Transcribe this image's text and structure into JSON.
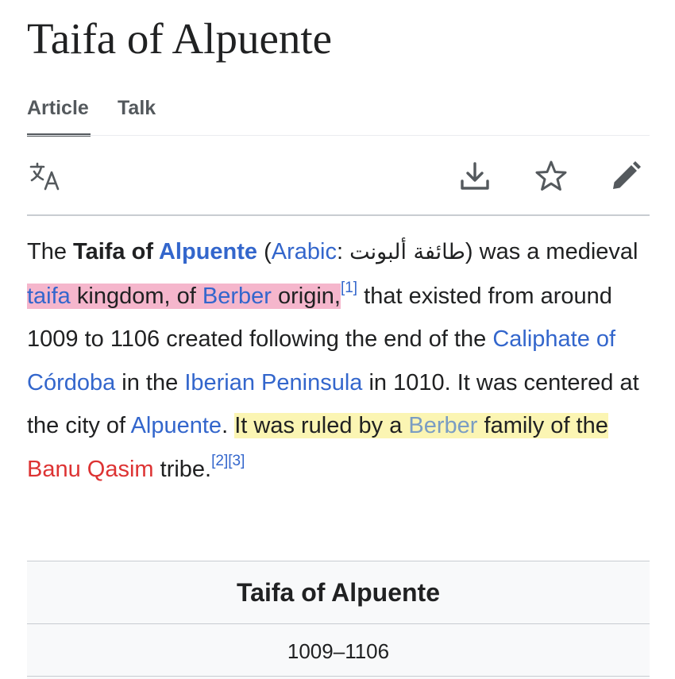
{
  "page": {
    "title": "Taifa of Alpuente"
  },
  "tabs": [
    {
      "label": "Article",
      "active": true
    },
    {
      "label": "Talk",
      "active": false
    }
  ],
  "toolbar": {
    "icons": [
      "language-icon",
      "download-icon",
      "star-icon",
      "edit-pencil-icon"
    ]
  },
  "intro": {
    "s1": "The ",
    "bold1": "Taifa of ",
    "bold_link": "Alpuente",
    "s2": " (",
    "link_arabic": "Arabic",
    "s3": ": ",
    "arabic_text": "طائفة ألبونت",
    "s4": ") was a medieval ",
    "link_taifa": "taifa",
    "s5": " kingdom, of ",
    "link_berber1": "Berber",
    "s6": " origin,",
    "ref1": "[1]",
    "s7": " that existed from around 1009 to 1106 created following the end of the ",
    "link_caliphate": "Caliphate of Córdoba",
    "s8": " in the ",
    "link_iberian": "Iberian Peninsula",
    "s9": " in 1010. It was centered at the city of ",
    "link_alpuente": "Alpuente",
    "s10": ". ",
    "s11": "It was ruled by a ",
    "link_berber2": "Berber",
    "s12": " family of the ",
    "link_banu": "Banu Qasim",
    "s13": " tribe.",
    "ref2": "[2]",
    "ref3": "[3]"
  },
  "infobox": {
    "title": "Taifa of Alpuente",
    "years": "1009–1106"
  },
  "colors": {
    "link": "#3366cc",
    "redlink": "#d33",
    "highlight_pink": "#f5b6cc",
    "highlight_yellow": "#fbf5b3"
  }
}
